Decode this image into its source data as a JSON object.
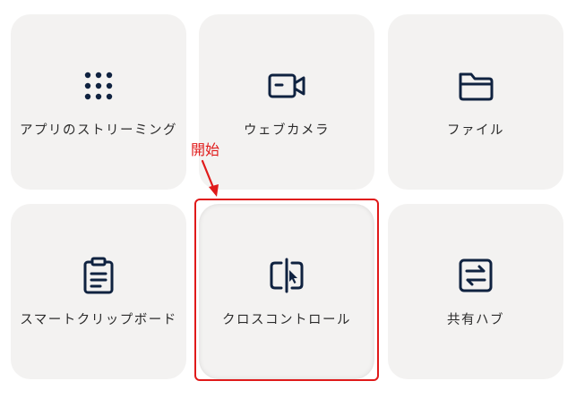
{
  "tiles": {
    "apps": {
      "label": "アプリのストリーミング",
      "icon": "app-grid-icon"
    },
    "webcam": {
      "label": "ウェブカメラ",
      "icon": "webcam-icon"
    },
    "files": {
      "label": "ファイル",
      "icon": "folder-icon"
    },
    "clipboard": {
      "label": "スマートクリップボード",
      "icon": "clipboard-icon"
    },
    "cross": {
      "label": "クロスコントロール",
      "icon": "cross-control-icon"
    },
    "hub": {
      "label": "共有ハブ",
      "icon": "share-hub-icon"
    }
  },
  "annotation": {
    "text": "開始",
    "color": "#e01a1a"
  },
  "colors": {
    "tile_bg": "#f3f2f1",
    "icon": "#0f2240",
    "label": "#2b2b2b"
  }
}
